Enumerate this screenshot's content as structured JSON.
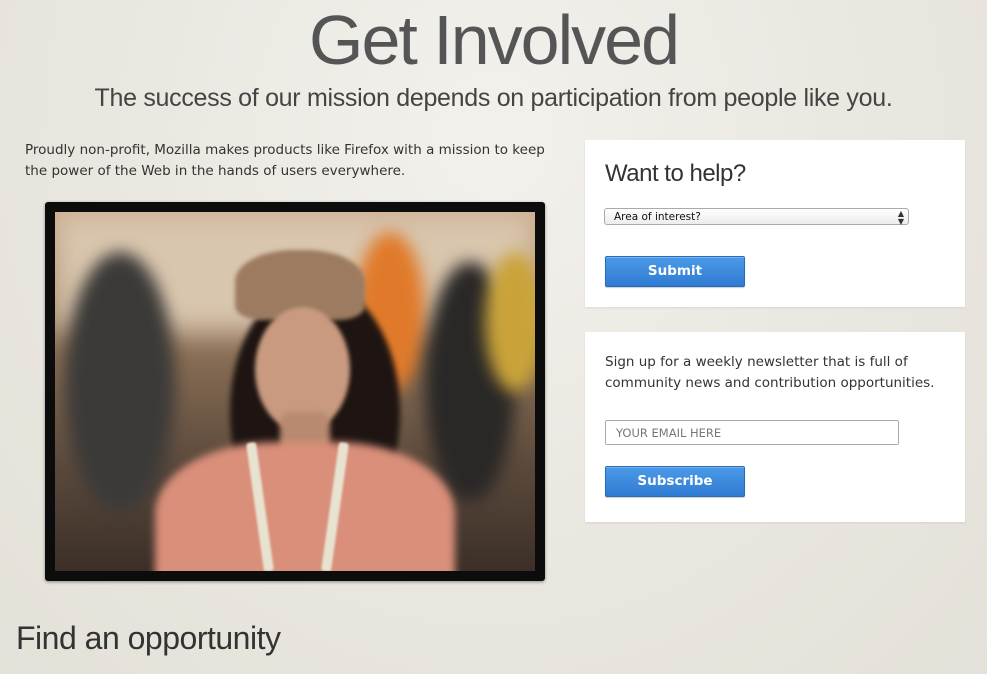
{
  "hero": {
    "title": "Get Involved",
    "subtitle": "The success of our mission depends on participation from people like you."
  },
  "intro": {
    "text": "Proudly non-profit, Mozilla makes products like Firefox with a mission to keep the power of the Web in the hands of users everywhere."
  },
  "help_panel": {
    "heading": "Want to help?",
    "select_value": "Area of interest?",
    "submit_label": "Submit"
  },
  "newsletter_panel": {
    "text": "Sign up for a weekly newsletter that is full of community news and contribution opportunities.",
    "email_placeholder": "YOUR EMAIL HERE",
    "subscribe_label": "Subscribe"
  },
  "find": {
    "heading": "Find an opportunity"
  },
  "colors": {
    "button_blue": "#2f7bd3",
    "background": "#ebe8e1"
  }
}
